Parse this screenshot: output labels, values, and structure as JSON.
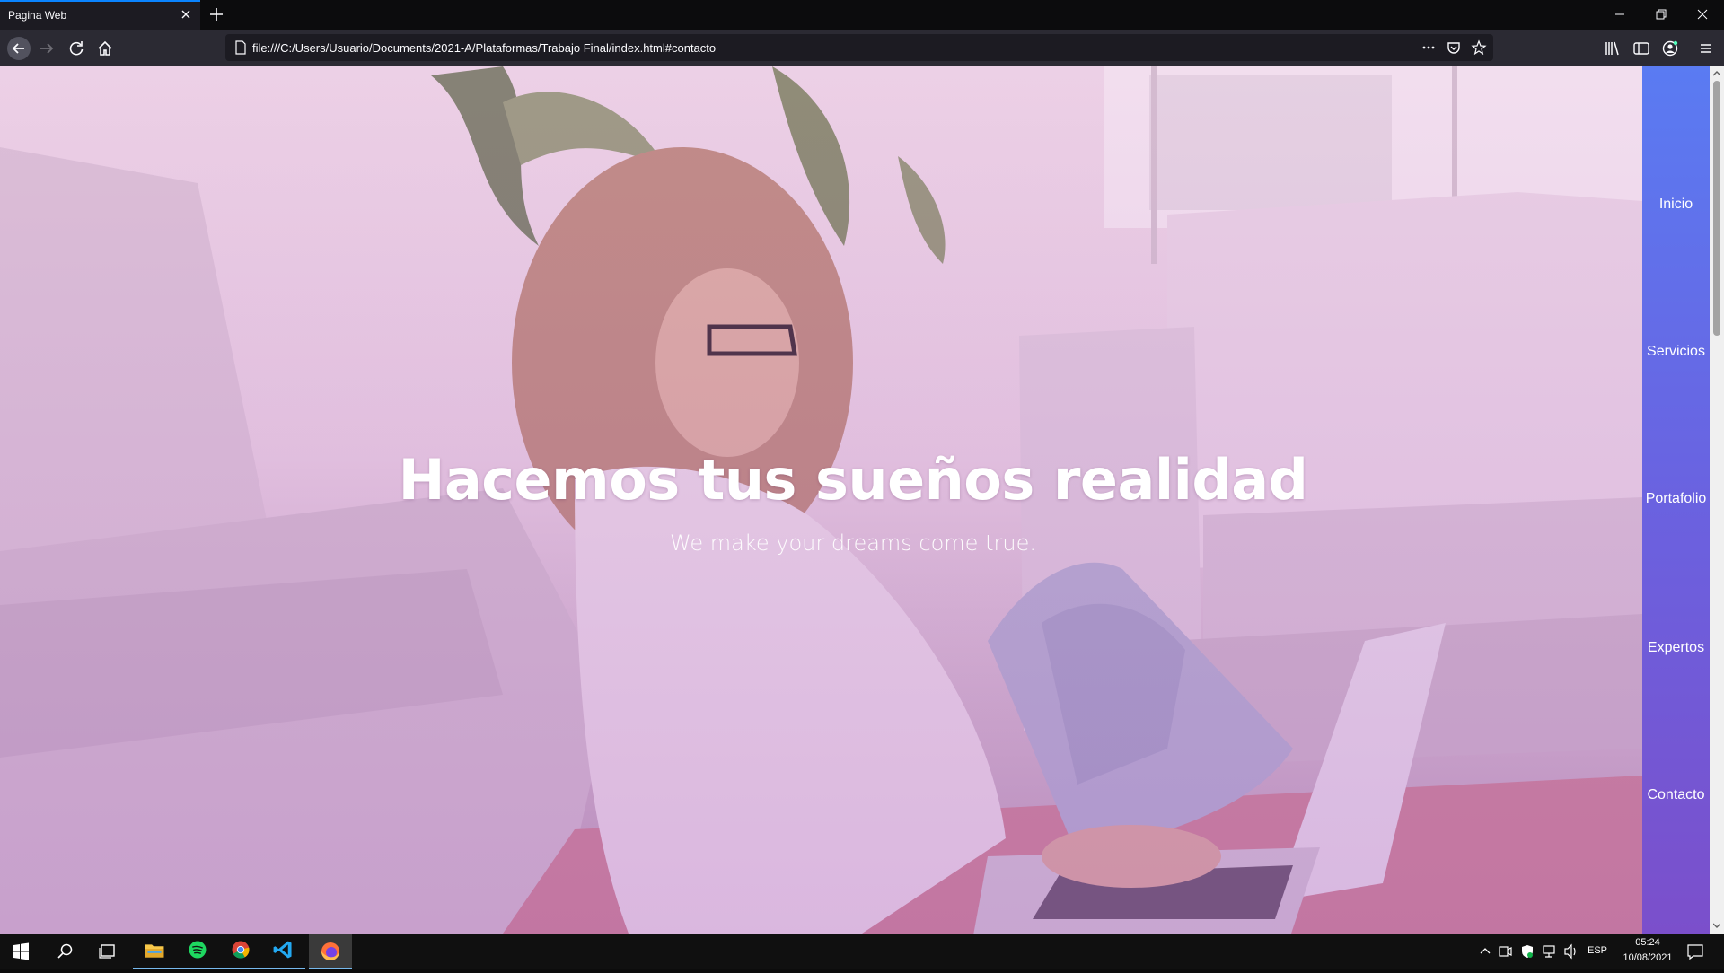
{
  "browser": {
    "tab_title": "Pagina Web",
    "url": "file:///C:/Users/Usuario/Documents/2021-A/Plataformas/Trabajo Final/index.html#contacto",
    "icons": [
      "back-icon",
      "forward-icon",
      "reload-icon",
      "home-icon",
      "page-icon",
      "more-icon",
      "pocket-icon",
      "bookmark-star-icon",
      "library-icon",
      "sidebar-icon",
      "account-icon",
      "menu-icon"
    ]
  },
  "hero": {
    "title": "Hacemos tus sueños realidad",
    "subtitle": "We make your dreams come true."
  },
  "sidenav": {
    "items": [
      {
        "label": "Inicio"
      },
      {
        "label": "Servicios"
      },
      {
        "label": "Portafolio"
      },
      {
        "label": "Expertos"
      },
      {
        "label": "Contacto"
      }
    ],
    "colors": {
      "top": "#5a7bf2",
      "bottom": "#7b4fcb"
    }
  },
  "taskbar": {
    "apps": [
      "windows-start-icon",
      "search-icon",
      "task-view-icon",
      "file-explorer-icon",
      "spotify-icon",
      "chrome-icon",
      "vscode-icon",
      "firefox-icon"
    ],
    "language": "ESP",
    "time": "05:24",
    "date": "10/08/2021"
  }
}
